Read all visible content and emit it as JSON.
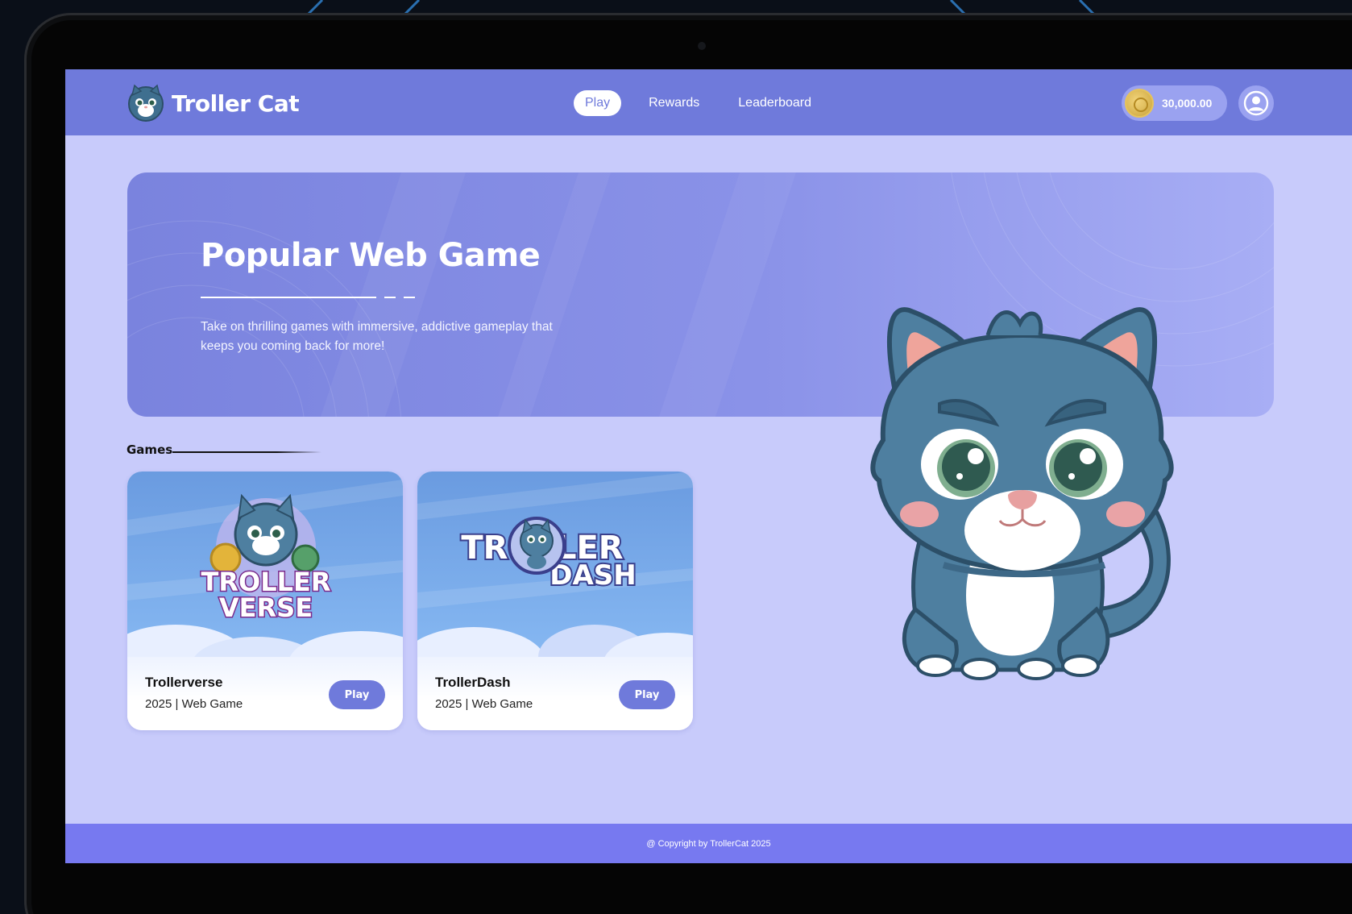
{
  "brand": {
    "name": "Troller Cat"
  },
  "nav": {
    "items": [
      {
        "label": "Play",
        "active": true
      },
      {
        "label": "Rewards",
        "active": false
      },
      {
        "label": "Leaderboard",
        "active": false
      }
    ]
  },
  "wallet": {
    "balance": "30,000.00",
    "icon": "coin-icon"
  },
  "profile": {
    "icon": "user-icon"
  },
  "hero": {
    "title": "Popular Web Game",
    "description": "Take on thrilling games with immersive, addictive gameplay that keeps you coming back for more!"
  },
  "games": {
    "section_label": "Games",
    "items": [
      {
        "title": "Trollerverse",
        "subtitle": "2025 | Web Game",
        "button": "Play",
        "logo_line1": "TROLLER",
        "logo_line2": "VERSE"
      },
      {
        "title": "TrollerDash",
        "subtitle": "2025 | Web Game",
        "button": "Play",
        "logo_line1": "TROLLER",
        "logo_line2": "DASH"
      }
    ]
  },
  "footer": {
    "copyright": "@ Copyright by TrollerCat 2025"
  },
  "colors": {
    "header": "#6f7adb",
    "page_bg": "#c8cbfb",
    "footer": "#7779f0",
    "accent": "#6f7adb",
    "cat_body": "#4e7fa0"
  }
}
